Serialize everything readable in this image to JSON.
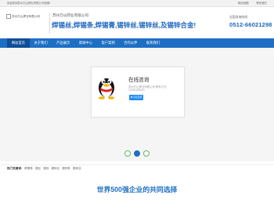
{
  "topbar": {
    "welcome": "欢迎来到苏州万山焊业有限公司官网!",
    "links": [
      "网站地图",
      "联系我们"
    ]
  },
  "header": {
    "logo_text": "苏州万山焊业有限公司",
    "company": "苏州万山焊业有限公司",
    "slogan": "焊锡丝,焊锡条,焊锡膏,锡锌丝,锡锌丝,及锡锌合金!",
    "hotline_label": "全国咨询热线:",
    "hotline": "0512-66021298"
  },
  "nav": [
    "网站首页",
    "关于我们",
    "产品展示",
    "新闻中心",
    "客户案例",
    "合作伙伴",
    "联系我们"
  ],
  "qq": {
    "title": "在线咨询",
    "line1": "苏州万山焊业有限公司  联系方式",
    "line2": "13291158023",
    "button": "QQ交谈"
  },
  "keywords": {
    "label": "热门关键词:",
    "items": [
      "焊锡条",
      "锡丝",
      "锡线",
      "锡锌丝",
      "锡锌条",
      "锡锌丝"
    ]
  },
  "section_title": "世界500强企业的共同选择",
  "colors": {
    "brand_blue": "#1d6fc4",
    "nav_active": "#0f4e98",
    "dot_green": "#5cb85c"
  }
}
